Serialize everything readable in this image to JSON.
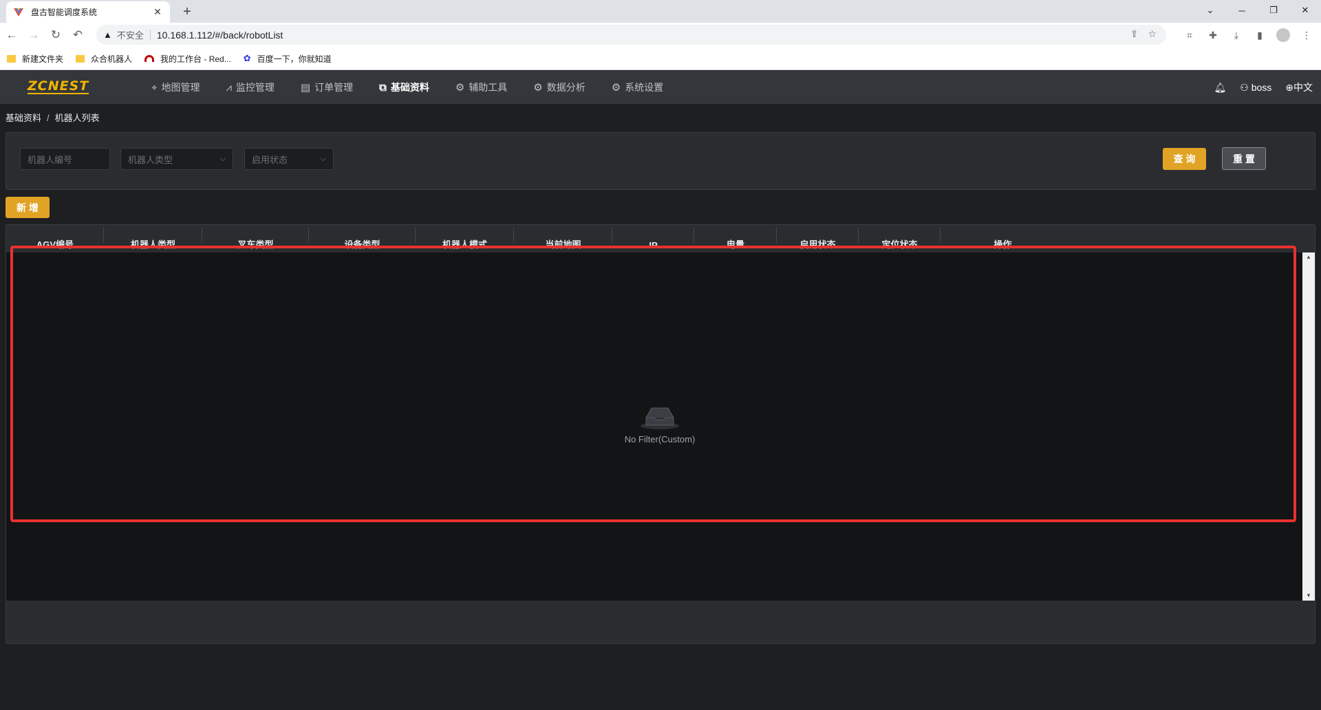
{
  "browser": {
    "tab_title": "盘古智能调度系统",
    "close_glyph": "✕",
    "new_tab_glyph": "+",
    "insecure_label": "不安全",
    "url": "10.168.1.112/#/back/robotList",
    "bookmarks": [
      "新建文件夹",
      "众合机器人",
      "我的工作台 - Red...",
      "百度一下，你就知道"
    ]
  },
  "app": {
    "logo": "ZCNEST",
    "accent_color": "#e0a325",
    "menu": [
      {
        "label": "地图管理",
        "icon": "map-pin-icon"
      },
      {
        "label": "监控管理",
        "icon": "chart-line-icon"
      },
      {
        "label": "订单管理",
        "icon": "document-icon"
      },
      {
        "label": "基础资料",
        "icon": "sliders-icon",
        "active": true
      },
      {
        "label": "辅助工具",
        "icon": "gear-icon"
      },
      {
        "label": "数据分析",
        "icon": "gear-icon"
      },
      {
        "label": "系统设置",
        "icon": "gear-icon"
      }
    ],
    "user": "boss",
    "language": "中文"
  },
  "breadcrumb": [
    "基础资料",
    "机器人列表"
  ],
  "breadcrumb_separator": "/",
  "filters": {
    "robot_number_placeholder": "机器人编号",
    "robot_type_placeholder": "机器人类型",
    "enable_status_placeholder": "启用状态",
    "query_label": "查 询",
    "reset_label": "重 置"
  },
  "add_label": "新 增",
  "table": {
    "columns": [
      "AGV编号",
      "机器人类型",
      "叉车类型",
      "设备类型",
      "机器人模式",
      "当前地图",
      "IP",
      "电量",
      "启用状态",
      "定位状态",
      "操作"
    ],
    "rows": [],
    "empty_text": "No Filter(Custom)"
  }
}
